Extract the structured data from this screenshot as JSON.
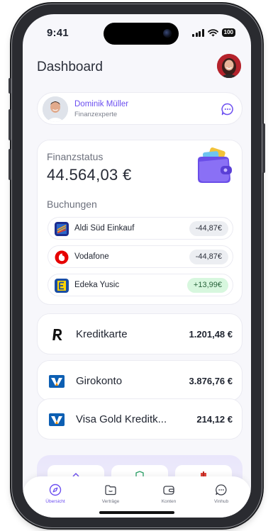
{
  "status_bar": {
    "time": "9:41",
    "battery": "100"
  },
  "header": {
    "title": "Dashboard",
    "avatar_icon": "user-avatar"
  },
  "advisor": {
    "name": "Dominik Müller",
    "role": "Finanzexperte",
    "action_icon": "chat-bubble-icon"
  },
  "finance": {
    "label": "Finanzstatus",
    "amount": "44.564,03 €",
    "illustration": "wallet-icon",
    "bookings_label": "Buchungen",
    "bookings": [
      {
        "name": "Aldi Süd Einkauf",
        "amount": "-44,87€",
        "logo": "aldi-logo",
        "positive": false
      },
      {
        "name": "Vodafone",
        "amount": "-44,87€",
        "logo": "vodafone-logo",
        "positive": false
      },
      {
        "name": "Edeka Yusic",
        "amount": "+13,99€",
        "logo": "edeka-logo",
        "positive": true
      }
    ]
  },
  "accounts": [
    {
      "name": "Kreditkarte",
      "value": "1.201,48 €",
      "icon": "revolut-logo"
    },
    {
      "name": "Girokonto",
      "value": "3.876,76 €",
      "icon": "volksbank-logo"
    },
    {
      "name": "Visa Gold Kreditk...",
      "value": "214,12 €",
      "icon": "volksbank-logo"
    }
  ],
  "tabs": [
    {
      "label": "Übersicht",
      "icon": "compass-icon",
      "active": true
    },
    {
      "label": "Verträge",
      "icon": "folder-icon",
      "active": false
    },
    {
      "label": "Konten",
      "icon": "wallet-icon",
      "active": false
    },
    {
      "label": "Vinhub",
      "icon": "chat-icon",
      "active": false
    }
  ],
  "colors": {
    "accent": "#6b4ef0",
    "positive_bg": "#d7f7de",
    "negative_bg": "#eceef2"
  }
}
